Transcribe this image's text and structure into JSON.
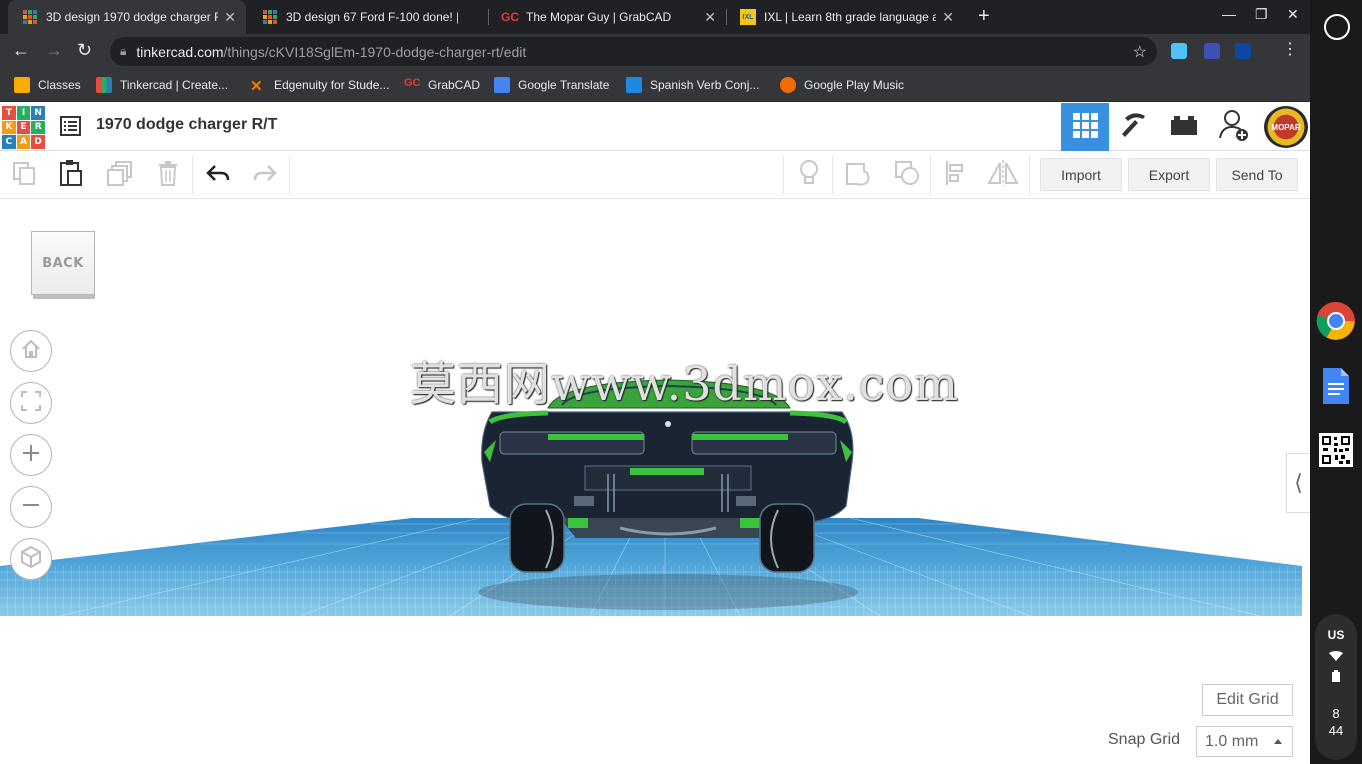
{
  "browser": {
    "tabs": [
      {
        "title": "3D design 1970 dodge charger R",
        "active": true
      },
      {
        "title": "3D design 67 Ford F-100 done! |",
        "active": false
      },
      {
        "title": "The Mopar Guy | GrabCAD",
        "active": false
      },
      {
        "title": "IXL | Learn 8th grade language a",
        "active": false
      }
    ],
    "url_host": "tinkercad.com",
    "url_path": "/things/cKVI18SglEm-1970-dodge-charger-rt/edit",
    "bookmarks": [
      {
        "label": "Classes"
      },
      {
        "label": "Tinkercad | Create..."
      },
      {
        "label": "Edgenuity for Stude..."
      },
      {
        "label": "GrabCAD"
      },
      {
        "label": "Google Translate"
      },
      {
        "label": "Spanish Verb Conj..."
      },
      {
        "label": "Google Play Music"
      }
    ]
  },
  "tinkercad": {
    "logo_letters": [
      "T",
      "I",
      "N",
      "K",
      "E",
      "R",
      "C",
      "A",
      "D"
    ],
    "design_title": "1970 dodge charger R/T",
    "avatar_text": "MOPAR",
    "toolbar": {
      "import_label": "Import",
      "export_label": "Export",
      "sendto_label": "Send To"
    },
    "viewcube_label": "BACK",
    "edit_grid_label": "Edit Grid",
    "snap_grid_label": "Snap Grid",
    "snap_grid_value": "1.0 mm"
  },
  "watermark": "莫西网www.3dmox.com",
  "shelf": {
    "ime": "US",
    "time_hour": "8",
    "time_minute": "44"
  }
}
